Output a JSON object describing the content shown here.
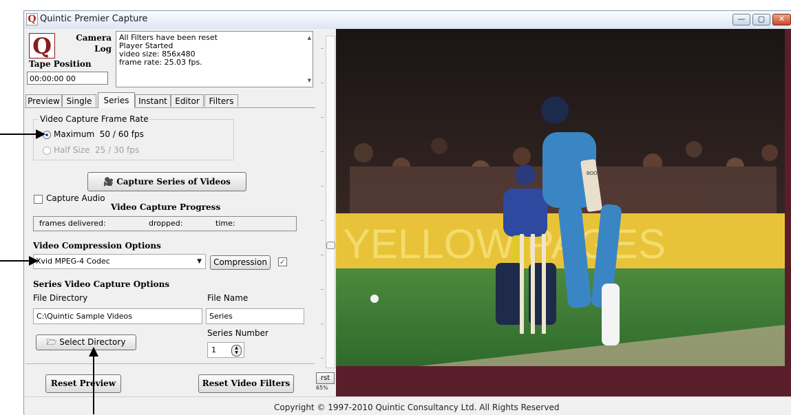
{
  "window": {
    "title": "Quintic Premier Capture",
    "logo_letter": "Q",
    "buttons": {
      "minimize": "—",
      "maximize": "▢",
      "close": "✕"
    }
  },
  "header": {
    "camera_log_label": "Camera Log",
    "camera_label_line1": "Camera",
    "camera_label_line2": "Log",
    "tape_position_label": "Tape Position",
    "tape_position_value": "00:00:00 00"
  },
  "log": {
    "lines": [
      "All Filters have been reset",
      "Player Started",
      "video size: 856x480",
      "frame rate: 25.03 fps."
    ]
  },
  "tabs": [
    {
      "label": "Preview",
      "active": false
    },
    {
      "label": "Single",
      "active": false
    },
    {
      "label": "Series",
      "active": true
    },
    {
      "label": "Instant",
      "active": false
    },
    {
      "label": "Editor",
      "active": false
    },
    {
      "label": "Filters",
      "active": false
    }
  ],
  "frame_rate": {
    "group_title": "Video Capture Frame Rate",
    "options": [
      {
        "label": "Maximum",
        "value": "50 / 60 fps",
        "selected": true,
        "enabled": true
      },
      {
        "label": "Half Size",
        "value": "25 / 30 fps",
        "selected": false,
        "enabled": false
      }
    ]
  },
  "capture": {
    "button_label": "Capture Series of Videos",
    "audio_label": "Capture Audio",
    "audio_checked": false,
    "progress_title": "Video Capture Progress",
    "progress_frames": "frames delivered:",
    "progress_dropped": "dropped:",
    "progress_time": "time:"
  },
  "compression": {
    "title": "Video Compression Options",
    "codec": "Xvid MPEG-4 Codec",
    "button_label": "Compression",
    "checked": true
  },
  "series_options": {
    "title": "Series Video Capture Options",
    "dir_label": "File Directory",
    "dir_value": "C:\\Quintic Sample Videos",
    "name_label": "File Name",
    "name_value": "Series",
    "select_dir_label": "Select Directory",
    "series_number_label": "Series Number",
    "series_number_value": "1"
  },
  "footer_buttons": {
    "reset_preview": "Reset Preview",
    "reset_filters": "Reset Video Filters",
    "rst": "rst",
    "zoom": "65%"
  },
  "video": {
    "banner_text": "YELLOW PAGES",
    "bat_label": "BOO"
  },
  "status": {
    "copyright": "Copyright © 1997-2010  Quintic Consultancy Ltd.  All Rights Reserved"
  },
  "colors": {
    "brand": "#8a1c1c",
    "video_border": "#5a1e2a",
    "banner": "#e8c33a",
    "pitch": "#3f7a3a"
  }
}
